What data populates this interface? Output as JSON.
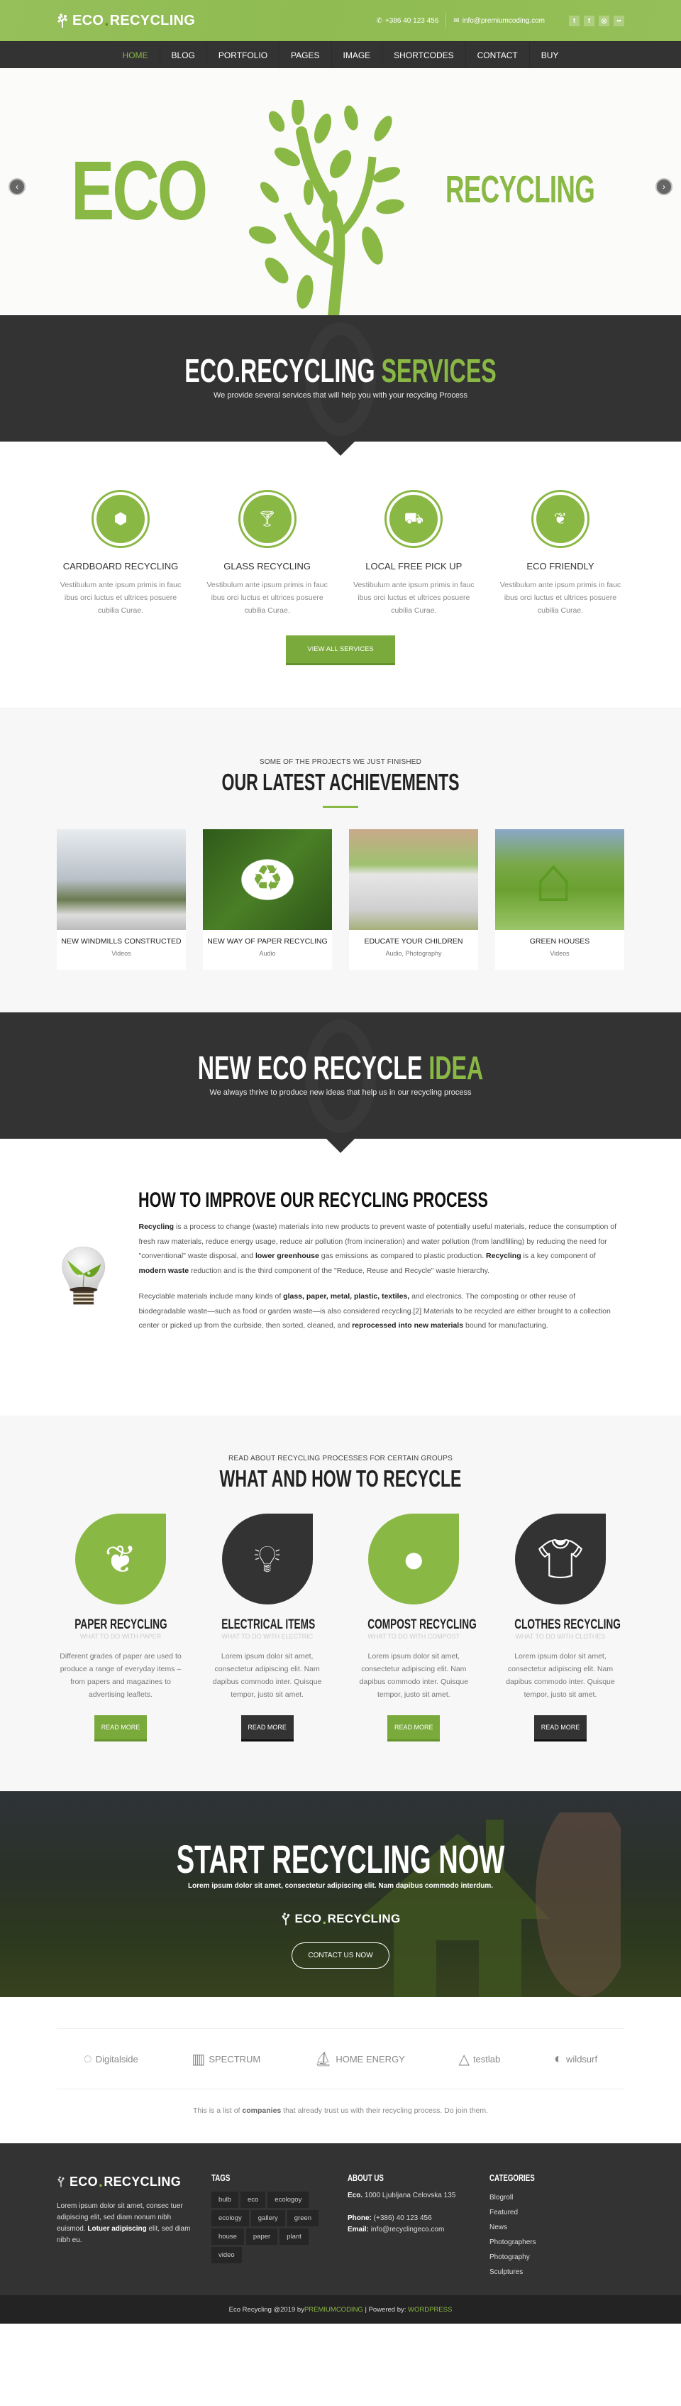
{
  "brand": {
    "name_left": "ECO",
    "name_right": "RECYCLING"
  },
  "topbar": {
    "phone": "+386 40 123 456",
    "email": "info@premiumcoding.com",
    "social": [
      "twitter-icon",
      "facebook-icon",
      "dribbble-icon",
      "flickr-icon"
    ]
  },
  "nav": {
    "items": [
      "HOME",
      "BLOG",
      "PORTFOLIO",
      "PAGES",
      "IMAGE",
      "SHORTCODES",
      "CONTACT",
      "BUY"
    ],
    "active": "HOME"
  },
  "hero": {
    "left_text": "ECO",
    "right_text": "RECYCLING",
    "prev": "‹",
    "next": "›"
  },
  "services_banner": {
    "title_white": "ECO.RECYCLING",
    "title_green": "SERVICES",
    "subtitle": "We provide several services that will help you with your recycling Process"
  },
  "services": {
    "items": [
      {
        "icon": "box-icon",
        "title": "CARDBOARD RECYCLING",
        "text": "Vestibulum ante ipsum primis in fauc ibus orci luctus et ultrices posuere cubilia Curae."
      },
      {
        "icon": "glass-icon",
        "title": "GLASS RECYCLING",
        "text": "Vestibulum ante ipsum primis in fauc ibus orci luctus et ultrices posuere cubilia Curae."
      },
      {
        "icon": "truck-icon",
        "title": "LOCAL FREE PICK UP",
        "text": "Vestibulum ante ipsum primis in fauc ibus orci luctus et ultrices posuere cubilia Curae."
      },
      {
        "icon": "leaf-icon",
        "title": "ECO FRIENDLY",
        "text": "Vestibulum ante ipsum primis in fauc ibus orci luctus et ultrices posuere cubilia Curae."
      }
    ],
    "button": "VIEW ALL SERVICES"
  },
  "achievements": {
    "subtitle": "SOME OF THE PROJECTS WE JUST FINISHED",
    "title": "OUR LATEST ACHIEVEMENTS",
    "items": [
      {
        "title": "NEW WINDMILLS CONSTRUCTED",
        "category": "Videos"
      },
      {
        "title": "NEW WAY OF PAPER RECYCLING",
        "category": "Audio"
      },
      {
        "title": "EDUCATE YOUR CHILDREN",
        "category": "Audio, Photography"
      },
      {
        "title": "GREEN HOUSES",
        "category": "Videos"
      }
    ]
  },
  "idea_banner": {
    "title_white": "NEW ECO RECYCLE",
    "title_green": "IDEA",
    "subtitle": "We always thrive to produce new ideas that help us in our recycling process"
  },
  "improve": {
    "title": "HOW TO IMPROVE OUR RECYCLING PROCESS",
    "p1": [
      {
        "b": "Recycling"
      },
      {
        "t": " is a process to change (waste) materials into new products to prevent waste of potentially useful materials, reduce the consumption of fresh raw materials, reduce energy usage, reduce air pollution (from incineration) and water pollution (from landfilling) by reducing the need for \"conventional\" waste disposal, and "
      },
      {
        "b": "lower greenhouse"
      },
      {
        "t": " gas emissions as compared to plastic production. "
      },
      {
        "b": "Recycling"
      },
      {
        "t": " is a key component of "
      },
      {
        "b": "modern waste"
      },
      {
        "t": " reduction and is the third component of the \"Reduce, Reuse and Recycle\" waste hierarchy."
      }
    ],
    "p2": [
      {
        "t": "Recyclable materials include many kinds of "
      },
      {
        "b": "glass, paper, metal, plastic, textiles,"
      },
      {
        "t": " and electronics. The composting or other reuse of biodegradable waste—such as food or garden waste—is also considered recycling.[2] Materials to be recycled are either brought to a collection center or picked up from the curbside, then sorted, cleaned, and "
      },
      {
        "b": "reprocessed into new materials"
      },
      {
        "t": " bound for manufacturing."
      }
    ]
  },
  "what": {
    "subtitle": "READ ABOUT RECYCLING PROCESSES FOR CERTAIN GROUPS",
    "title": "WHAT AND HOW TO RECYCLE",
    "items": [
      {
        "icon": "tree-icon",
        "title": "PAPER RECYCLING",
        "sub": "WHAT TO DO WITH PAPER",
        "text": "Different grades of paper are used to produce a range of everyday items – from papers and magazines to advertising leaflets.",
        "button": "READ MORE",
        "color": "green"
      },
      {
        "icon": "bulb-icon",
        "title": "ELECTRICAL ITEMS",
        "sub": "WHAT TO DO WITH ELECTRIC",
        "text": "Lorem ipsum dolor sit amet, consectetur adipiscing elit. Nam dapibus commodo inter. Quisque tempor, justo sit amet.",
        "button": "READ MORE",
        "color": "dark"
      },
      {
        "icon": "apple-icon",
        "title": "COMPOST RECYCLING",
        "sub": "WHAT TO DO WITH COMPOST",
        "text": "Lorem ipsum dolor sit amet, consectetur adipiscing elit. Nam dapibus commodo inter. Quisque tempor, justo sit amet.",
        "button": "READ MORE",
        "color": "green"
      },
      {
        "icon": "shirt-icon",
        "title": "CLOTHES RECYCLING",
        "sub": "WHAT TO DO WITH CLOTHES",
        "text": "Lorem ipsum dolor sit amet, consectetur adipiscing elit. Nam dapibus commodo inter. Quisque tempor, justo sit amet.",
        "button": "READ MORE",
        "color": "dark"
      }
    ]
  },
  "cta": {
    "title": "START RECYCLING NOW",
    "subtitle": "Lorem ipsum dolor sit amet, consectetur adipiscing elit. Nam dapibus commodo interdum.",
    "button": "CONTACT US NOW"
  },
  "clients": {
    "logos": [
      "Digitalside",
      "SPECTRUM",
      "HOME ENERGY",
      "testlab",
      "wildsurf"
    ],
    "note_pre": "This is a list of ",
    "note_bold": "companies",
    "note_post": " that already trust us with their recycling process. Do join them."
  },
  "footer": {
    "about_text_pre": "Lorem ipsum dolor sit amet, consec tuer adipiscing elit, sed diam nonum nibh euismod. ",
    "about_text_bold": "Lotuer adipiscing",
    "about_text_post": " elit, sed diam nibh eu.",
    "tags_title": "TAGS",
    "tags": [
      "bulb",
      "eco",
      "ecologoy",
      "ecology",
      "gallery",
      "green",
      "house",
      "paper",
      "plant",
      "video"
    ],
    "about_title": "ABOUT US",
    "address_label": "Eco.",
    "address": " 1000 Ljubljana Celovska 135",
    "phone_label": "Phone:",
    "phone": " (+386) 40 123 456",
    "email_label": "Email:",
    "email": " info@recyclingeco.com",
    "categories_title": "CATEGORIES",
    "categories": [
      "Blogroll",
      "Featured",
      "News",
      "Photographers",
      "Photography",
      "Sculptures"
    ],
    "copyright": "Eco Recycling @2019 by ",
    "author": "PREMIUMCODING",
    "powered": " | Powered by: ",
    "platform": "WORDPRESS"
  },
  "colors": {
    "accent": "#8ab845",
    "dark": "#333333",
    "footer_bottom": "#232323"
  }
}
